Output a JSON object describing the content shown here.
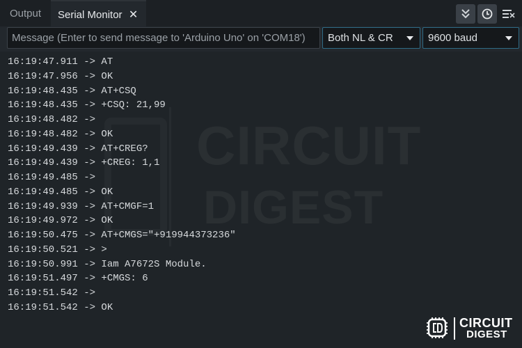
{
  "tabs": {
    "output_label": "Output",
    "serial_label": "Serial Monitor",
    "close_symbol": "✕"
  },
  "toolbar_icons": [
    "toggle-autoscroll-icon",
    "toggle-timestamp-icon",
    "clear-output-icon"
  ],
  "input": {
    "placeholder": "Message (Enter to send message to 'Arduino Uno' on 'COM18')",
    "value": ""
  },
  "line_ending": {
    "selected": "Both NL & CR"
  },
  "baud_rate": {
    "selected": "9600 baud"
  },
  "lines": [
    "16:19:47.911 -> AT",
    "16:19:47.956 -> OK",
    "16:19:48.435 -> AT+CSQ",
    "16:19:48.435 -> +CSQ: 21,99",
    "16:19:48.482 -> ",
    "16:19:48.482 -> OK",
    "16:19:49.439 -> AT+CREG?",
    "16:19:49.439 -> +CREG: 1,1",
    "16:19:49.485 -> ",
    "16:19:49.485 -> OK",
    "16:19:49.939 -> AT+CMGF=1",
    "16:19:49.972 -> OK",
    "16:19:50.475 -> AT+CMGS=\"+919944373236\"",
    "16:19:50.521 -> >",
    "16:19:50.991 -> Iam A7672S Module.",
    "16:19:51.497 -> +CMGS: 6",
    "16:19:51.542 -> ",
    "16:19:51.542 -> OK"
  ],
  "watermark": {
    "line1": "CIRCUIT",
    "line2": "DIGEST"
  },
  "logo": {
    "line1": "CIRCUIT",
    "line2": "DIGEST"
  },
  "colors": {
    "background": "#1f2428",
    "accent_border": "#2f6b86",
    "text": "#d6d9dc"
  }
}
